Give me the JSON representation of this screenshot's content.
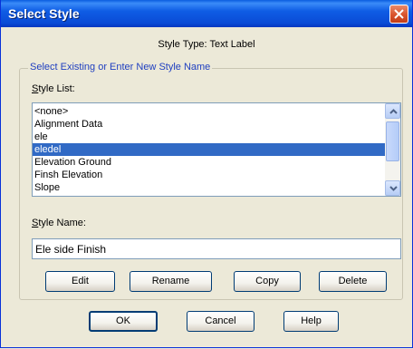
{
  "window": {
    "title": "Select Style",
    "style_type_line": "Style Type: Text Label"
  },
  "group": {
    "legend": "Select Existing or Enter New Style Name",
    "list_label_mnemonic": "S",
    "list_label_rest": "tyle List:",
    "list_items": [
      "<none>",
      "Alignment Data",
      "ele",
      "eledel",
      "Elevation Ground",
      "Finsh Elevation",
      "Slope"
    ],
    "selected_index": 3,
    "name_label_mnemonic": "S",
    "name_label_rest": "tyle Name:",
    "name_value": "Ele side Finish"
  },
  "buttons": {
    "edit": "Edit",
    "rename": "Rename",
    "copy": "Copy",
    "delete": "Delete",
    "ok": "OK",
    "cancel": "Cancel",
    "help": "Help"
  },
  "colors": {
    "titlebar": "#0a4bd6",
    "selection": "#316ac5",
    "close": "#d9532d"
  },
  "icons": {
    "close": "close-icon",
    "scroll_up": "chevron-up-icon",
    "scroll_down": "chevron-down-icon"
  }
}
